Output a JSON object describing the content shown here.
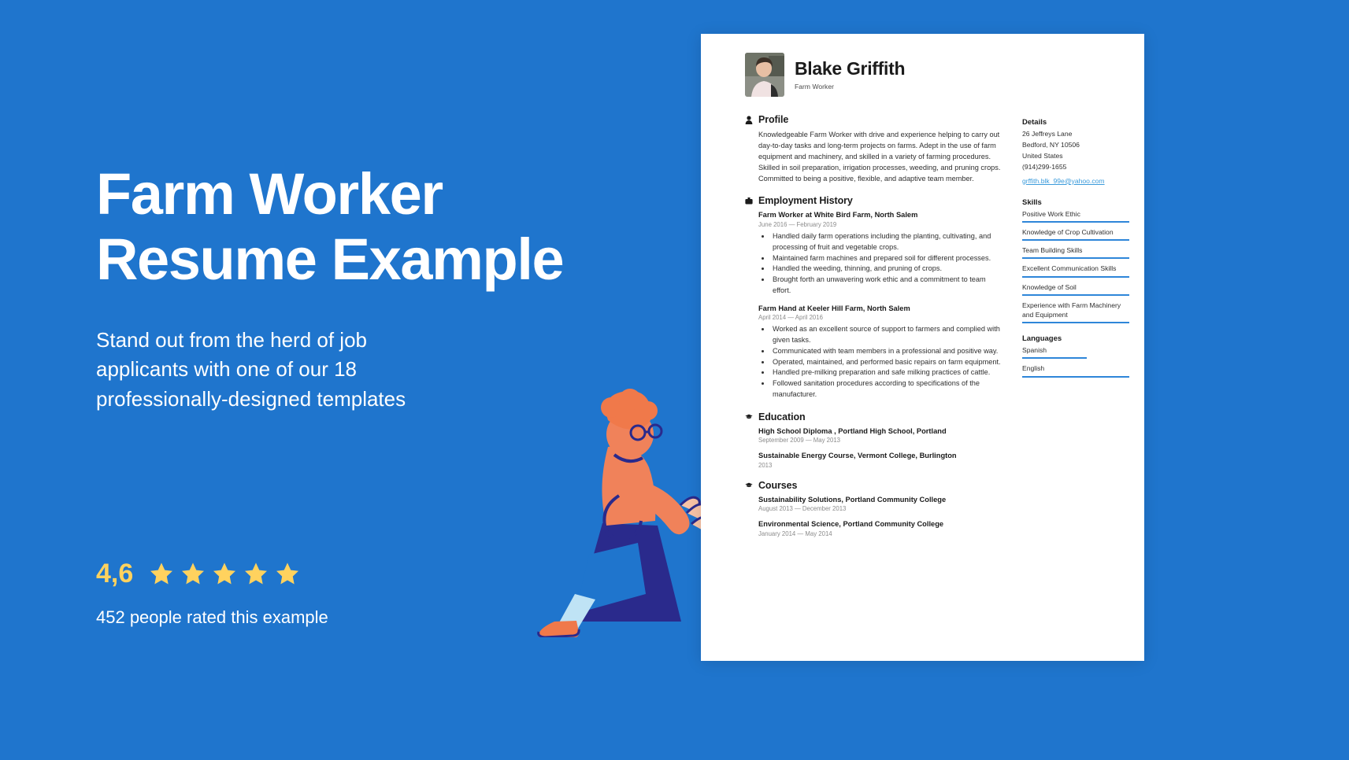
{
  "theme": {
    "background": "#1f75cd",
    "accent": "#2e86d9",
    "star": "#ffd25e",
    "link": "#3b9bdb"
  },
  "promo": {
    "headline_line1": "Farm Worker",
    "headline_line2": "Resume Example",
    "sub_line1": "Stand out from the herd of job",
    "sub_line2": "applicants with one of our 18",
    "sub_line3": "professionally-designed templates",
    "rating_score": "4,6",
    "rating_count_text": "452 people rated this example",
    "stars": 5
  },
  "resume": {
    "candidate_name": "Blake Griffith",
    "candidate_role": "Farm Worker",
    "sections": {
      "profile": {
        "title": "Profile",
        "icon": "person-icon",
        "text": "Knowledgeable Farm Worker with drive and experience helping to carry out day-to-day tasks and long-term projects on farms. Adept in the use of farm equipment and machinery, and skilled in a variety of farming procedures. Skilled in soil preparation, irrigation processes, weeding, and pruning crops. Committed to being a positive, flexible, and adaptive team member."
      },
      "employment": {
        "title": "Employment History",
        "icon": "briefcase-icon",
        "jobs": [
          {
            "title": "Farm Worker at White Bird Farm, North Salem",
            "date": "June 2016 — February 2019",
            "bullets": [
              "Handled daily farm operations including the planting, cultivating, and processing of fruit and vegetable crops.",
              "Maintained farm machines and prepared soil for different processes.",
              "Handled the weeding, thinning, and pruning of crops.",
              "Brought forth an unwavering work ethic and a commitment to team effort."
            ]
          },
          {
            "title": "Farm Hand at Keeler Hill Farm, North Salem",
            "date": "April 2014 — April 2016",
            "bullets": [
              "Worked as an excellent source of support to farmers and complied with given tasks.",
              "Communicated with team members in a professional and positive way.",
              "Operated, maintained, and performed basic repairs on farm equipment.",
              "Handled pre-milking preparation and safe milking practices of cattle.",
              "Followed sanitation procedures according to specifications of the manufacturer."
            ]
          }
        ]
      },
      "education": {
        "title": "Education",
        "icon": "graduation-cap-icon",
        "items": [
          {
            "title": "High School Diploma , Portland High School, Portland",
            "date": "September 2009 — May 2013"
          },
          {
            "title": "Sustainable Energy Course,  Vermont College, Burlington",
            "date": "2013"
          }
        ]
      },
      "courses": {
        "title": "Courses",
        "icon": "graduation-cap-icon",
        "items": [
          {
            "title": "Sustainability Solutions, Portland Community College",
            "date": "August 2013 — December 2013"
          },
          {
            "title": "Environmental Science, Portland Community College",
            "date": "January 2014 — May 2014"
          }
        ]
      }
    },
    "side": {
      "details": {
        "title": "Details",
        "lines": [
          "26 Jeffreys Lane",
          "Bedford, NY 10506",
          "United States",
          "(914)299-1655"
        ],
        "email": "grffith.blk_99e@yahoo.com"
      },
      "skills": {
        "title": "Skills",
        "items": [
          {
            "label": "Positive Work Ethic",
            "level": 100
          },
          {
            "label": "Knowledge of Crop Cultivation",
            "level": 100
          },
          {
            "label": "Team Building Skills",
            "level": 100
          },
          {
            "label": "Excellent Communication Skills",
            "level": 100
          },
          {
            "label": "Knowledge of Soil",
            "level": 100
          },
          {
            "label": "Experience with Farm Machinery and Equipment",
            "level": 100
          }
        ]
      },
      "languages": {
        "title": "Languages",
        "items": [
          {
            "label": "Spanish",
            "level": 60
          },
          {
            "label": "English",
            "level": 100
          }
        ]
      }
    }
  }
}
